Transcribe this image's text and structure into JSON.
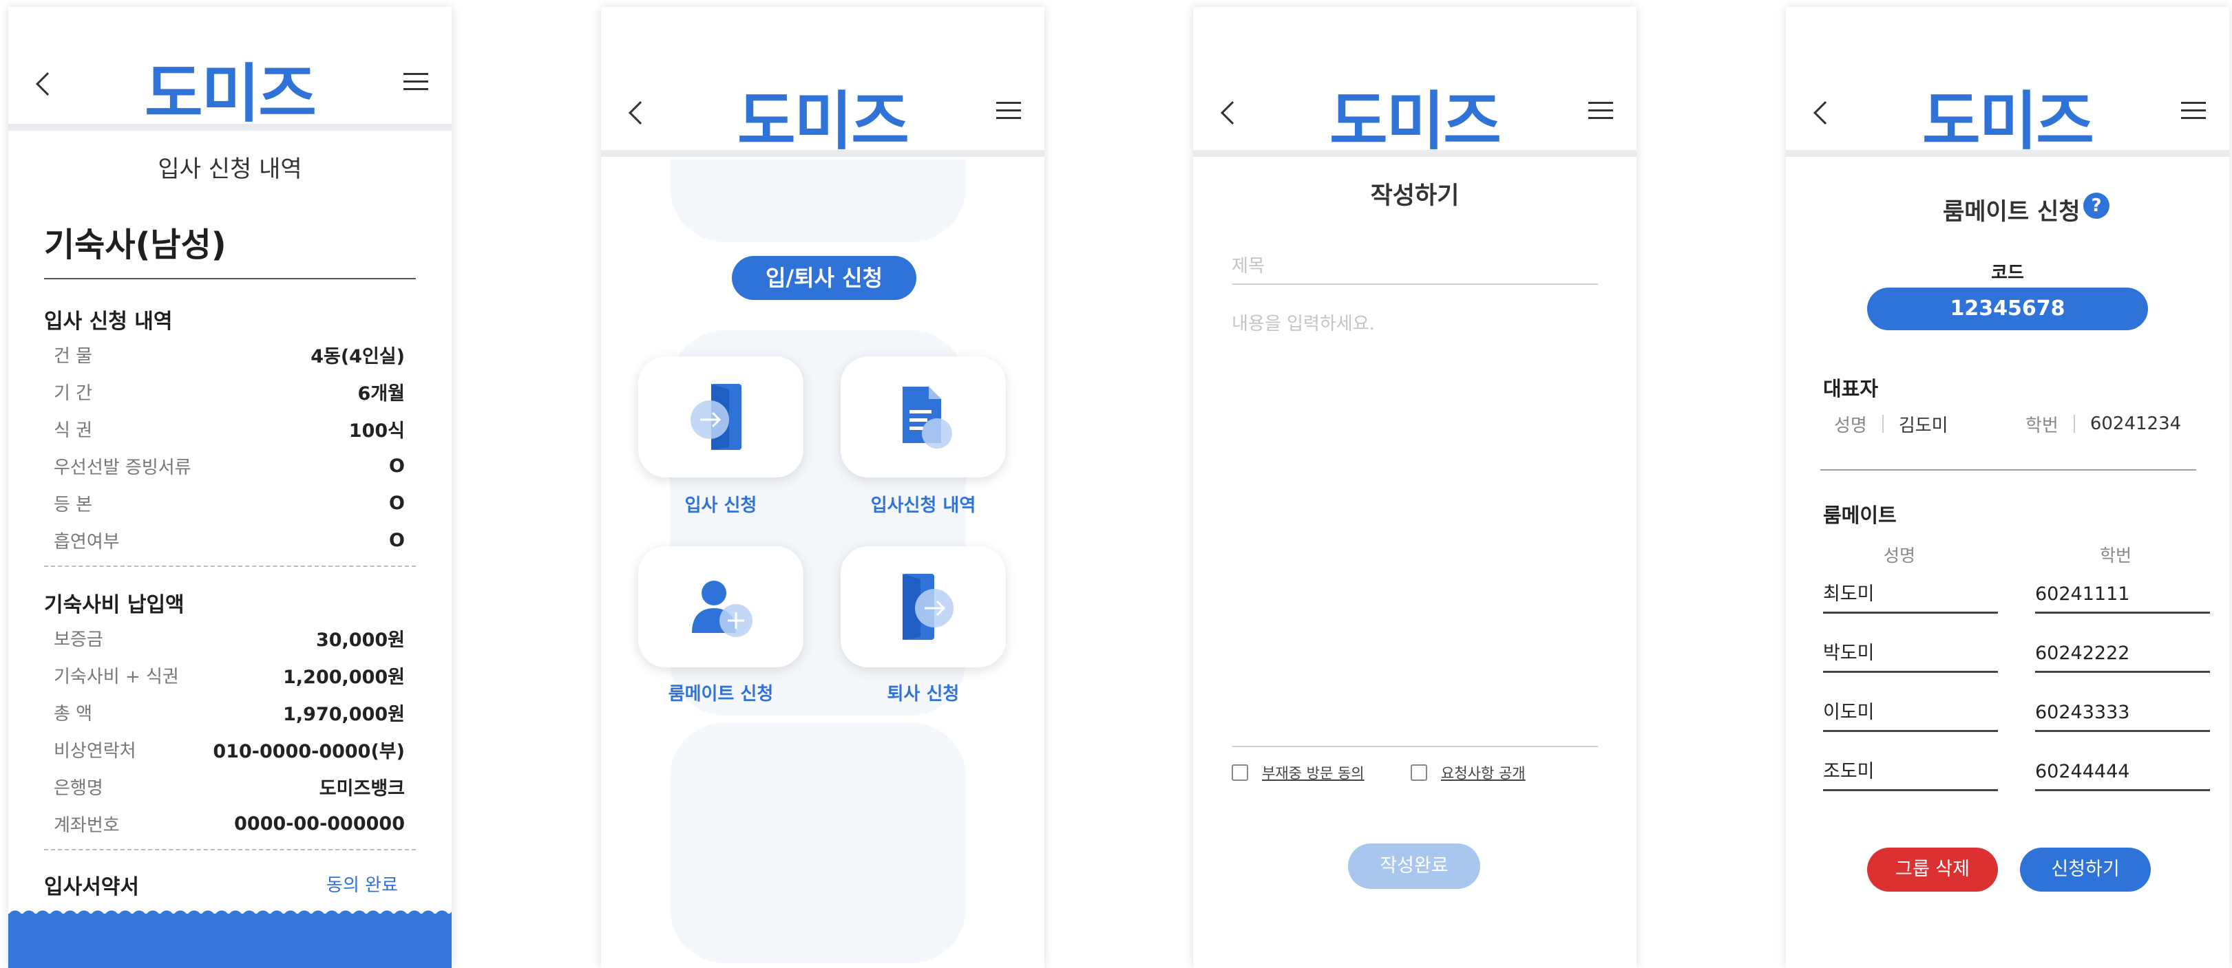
{
  "brand": {
    "logo": "도미즈",
    "primary_color": "#2f73d9",
    "danger_color": "#dc3131"
  },
  "header_icons": {
    "back": "chevron-left-icon",
    "menu": "hamburger-menu-icon"
  },
  "screen1": {
    "title": "입사 신청 내역",
    "dorm": "기숙사(남성)",
    "section1": {
      "title": "입사 신청 내역",
      "rows": [
        {
          "k": "건 물",
          "v": "4동(4인실)"
        },
        {
          "k": "기 간",
          "v": "6개월"
        },
        {
          "k": "식 권",
          "v": "100식"
        },
        {
          "k": "우선선발 증빙서류",
          "v": "O"
        },
        {
          "k": "등 본",
          "v": "O"
        },
        {
          "k": "흡연여부",
          "v": "O"
        }
      ]
    },
    "section2": {
      "title": "기숙사비 납입액",
      "rows": [
        {
          "k": "보증금",
          "v": "30,000원"
        },
        {
          "k": "기숙사비 + 식권",
          "v": "1,200,000원"
        },
        {
          "k": "총 액",
          "v": "1,970,000원"
        },
        {
          "k": "비상연락처",
          "v": "010-0000-0000(부)"
        },
        {
          "k": "은행명",
          "v": "도미즈뱅크"
        },
        {
          "k": "계좌번호",
          "v": "0000-00-000000"
        }
      ]
    },
    "pledge": {
      "title": "입사서약서",
      "status": "동의 완료"
    }
  },
  "screen2": {
    "pill": "입/퇴사 신청",
    "cards": [
      {
        "label": "입사 신청",
        "icon": "door-enter-icon"
      },
      {
        "label": "입사신청 내역",
        "icon": "document-search-icon"
      },
      {
        "label": "룸메이트 신청",
        "icon": "user-add-icon"
      },
      {
        "label": "퇴사 신청",
        "icon": "door-exit-icon"
      }
    ]
  },
  "screen3": {
    "title": "작성하기",
    "subject_placeholder": "제목",
    "content_placeholder": "내용을 입력하세요.",
    "check1": "부재중 방문 동의",
    "check2": "요청사항 공개",
    "submit": "작성완료"
  },
  "screen4": {
    "title": "룸메이트 신청",
    "help": "?",
    "code_label": "코드",
    "code": "12345678",
    "rep": {
      "title": "대표자",
      "name_label": "성명",
      "name": "김도미",
      "id_label": "학번",
      "id": "60241234"
    },
    "roommates": {
      "title": "룸메이트",
      "name_header": "성명",
      "id_header": "학번",
      "rows": [
        {
          "name": "최도미",
          "id": "60241111"
        },
        {
          "name": "박도미",
          "id": "60242222"
        },
        {
          "name": "이도미",
          "id": "60243333"
        },
        {
          "name": "조도미",
          "id": "60244444"
        }
      ]
    },
    "delete_btn": "그룹 삭제",
    "apply_btn": "신청하기"
  }
}
